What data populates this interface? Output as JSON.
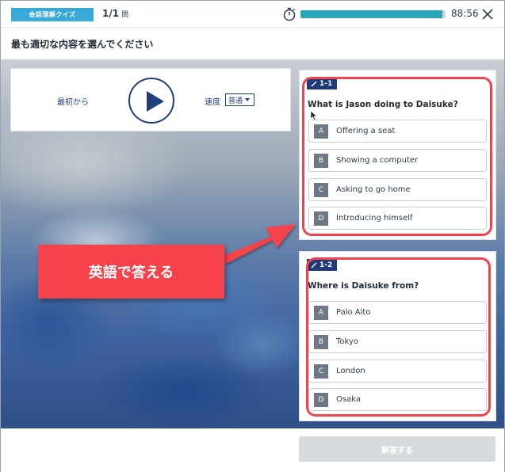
{
  "header": {
    "quiz_label": "会話理解クイズ",
    "counter_current": "1/1",
    "counter_unit": "問",
    "progress_fraction": 0.98,
    "timer": "88:56"
  },
  "instruction": "最も適切な内容を選んでください",
  "player": {
    "restart_label": "最初から",
    "speed_label": "速度",
    "speed_value": "普通"
  },
  "questions": [
    {
      "badge": "1-1",
      "text": "What is Jason doing to Daisuke?",
      "options": [
        {
          "letter": "A",
          "text": "Offering a seat"
        },
        {
          "letter": "B",
          "text": "Showing a computer"
        },
        {
          "letter": "C",
          "text": "Asking to go home"
        },
        {
          "letter": "D",
          "text": "Introducing himself"
        }
      ]
    },
    {
      "badge": "1-2",
      "text": "Where is Daisuke from?",
      "options": [
        {
          "letter": "A",
          "text": "Palo Alto"
        },
        {
          "letter": "B",
          "text": "Tokyo"
        },
        {
          "letter": "C",
          "text": "London"
        },
        {
          "letter": "D",
          "text": "Osaka"
        }
      ]
    }
  ],
  "callout_text": "英語で答える",
  "submit_label": "解答する",
  "colors": {
    "accent": "#3aa8d8",
    "navy": "#1f3f7a",
    "highlight": "#f0424f",
    "callout": "#f5424b",
    "progress": "#27a8b8"
  }
}
